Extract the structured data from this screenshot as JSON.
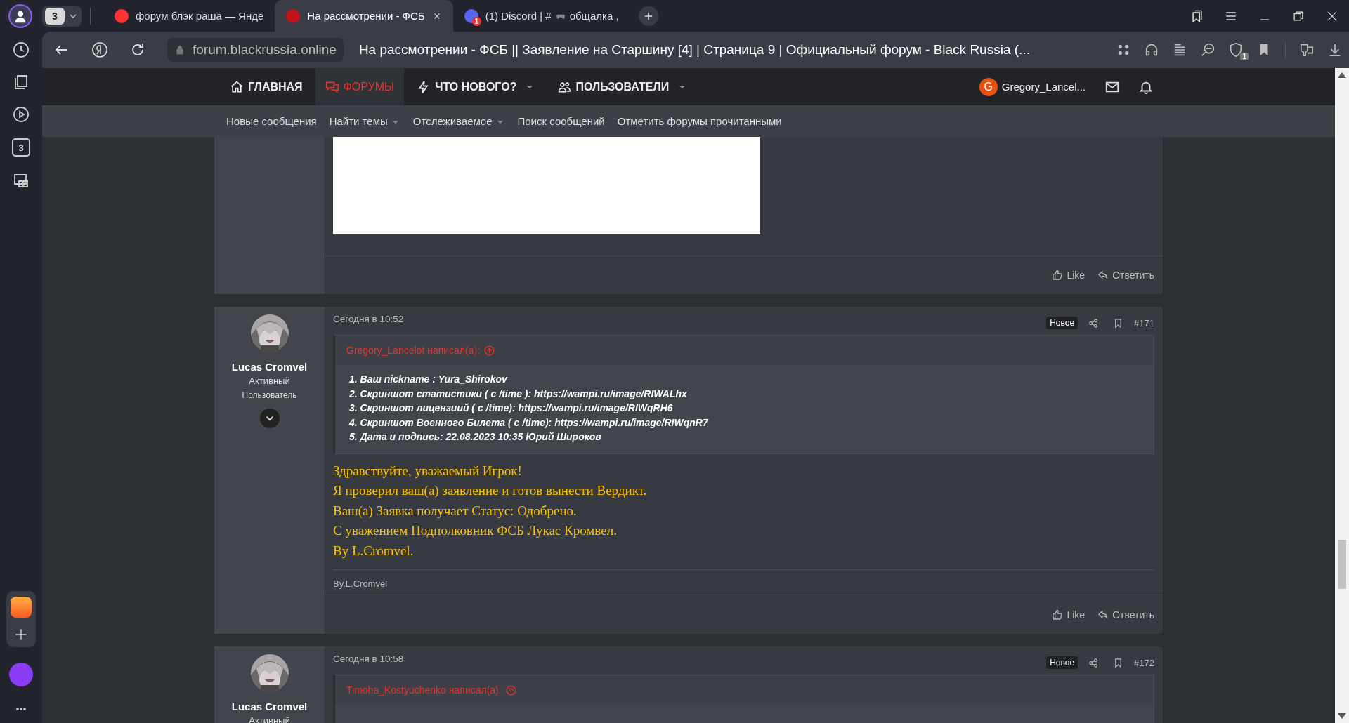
{
  "browser": {
    "tab_group_count": "3",
    "tabs": [
      {
        "title": "форум блэк раша — Янде",
        "selected": false
      },
      {
        "title": "На рассмотрении - ФСБ",
        "selected": true
      },
      {
        "title": "(1) Discord | #",
        "title_end": "общалка ,",
        "selected": false,
        "badge": "1"
      }
    ],
    "address": "forum.blackrussia.online",
    "page_title": "На рассмотрении - ФСБ || Заявление на Старшину [4] | Страница 9 | Официальный форум - Black Russia (...",
    "shield_badge": "1",
    "sidebar_tab_count": "3"
  },
  "forum_nav": {
    "items": [
      {
        "label": "ГЛАВНАЯ",
        "selected": false,
        "dropdown": false
      },
      {
        "label": "ФОРУМЫ",
        "selected": true,
        "dropdown": false
      },
      {
        "label": "ЧТО НОВОГО?",
        "selected": false,
        "dropdown": true
      },
      {
        "label": "ПОЛЬЗОВАТЕЛИ",
        "selected": false,
        "dropdown": true
      }
    ],
    "user": {
      "initial": "G",
      "name": "Gregory_Lancel..."
    }
  },
  "sub_nav": [
    {
      "label": "Новые сообщения",
      "dropdown": false
    },
    {
      "label": "Найти темы",
      "dropdown": true
    },
    {
      "label": "Отслеживаемое",
      "dropdown": true
    },
    {
      "label": "Поиск сообщений",
      "dropdown": false
    },
    {
      "label": "Отметить форумы прочитанными",
      "dropdown": false
    }
  ],
  "posts": [
    {
      "kind": "tail",
      "actions": [
        "Like",
        "Ответить"
      ]
    },
    {
      "kind": "full",
      "author": "Lucas Cromvel",
      "titles": [
        "Активный",
        "Пользователь"
      ],
      "date": "Сегодня в 10:52",
      "badge": "Новое",
      "number": "#171",
      "quote": {
        "author": "Gregory_Lancelot написал(а):",
        "lines": [
          "1. Ваш nickname : Yura_Shirokov",
          "2. Скриншот статистики ( c /time ): https://wampi.ru/image/RIWALhx",
          "3. Скриншот лицензиий ( c /time): https://wampi.ru/image/RIWqRH6",
          "4. Скриншот Военного Билета ( c /time): https://wampi.ru/image/RIWqnR7",
          "5. Дата и подпись: 22.08.2023 10:35 Юрий Широков"
        ]
      },
      "message": [
        "Здравствуйте, уважаемый Игрок!",
        "Я проверил ваш(а) заявление и готов вынести Вердикт.",
        "Ваш(а) Заявка получает Статус: Одобрено.",
        "С уважением Подполковник ФСБ Лукас Кромвел.",
        "By L.Cromvel."
      ],
      "signature": "By.L.Cromvel",
      "actions": [
        "Like",
        "Ответить"
      ]
    },
    {
      "kind": "head",
      "author": "Lucas Cromvel",
      "titles": [
        "Активный"
      ],
      "date": "Сегодня в 10:58",
      "badge": "Новое",
      "number": "#172",
      "quote": {
        "author": "Timoha_Kostyuchenko написал(а):"
      }
    }
  ]
}
